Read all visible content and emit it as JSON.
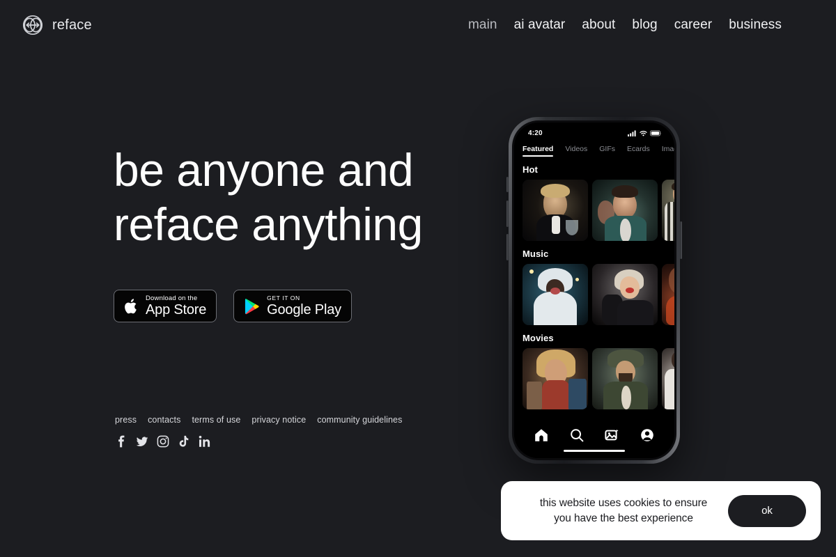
{
  "brand": {
    "name": "reface",
    "icon": "globe-swap-icon"
  },
  "nav": {
    "items": [
      {
        "label": "main",
        "active": false
      },
      {
        "label": "ai avatar"
      },
      {
        "label": "about"
      },
      {
        "label": "blog"
      },
      {
        "label": "career"
      },
      {
        "label": "business"
      }
    ]
  },
  "hero": {
    "headline_line1": "be anyone and",
    "headline_line2": "reface anything",
    "badges": [
      {
        "icon": "apple-icon",
        "small": "Download on the",
        "big": "App Store"
      },
      {
        "icon": "google-play-icon",
        "small": "GET IT ON",
        "big": "Google Play"
      }
    ]
  },
  "footer": {
    "links": [
      "press",
      "contacts",
      "terms of use",
      "privacy notice",
      "community guidelines"
    ],
    "socials": [
      "facebook-icon",
      "twitter-icon",
      "instagram-icon",
      "tiktok-icon",
      "linkedin-icon"
    ]
  },
  "phone": {
    "status": {
      "time": "4:20",
      "icons": [
        "cellular-signal-icon",
        "wifi-icon",
        "battery-icon"
      ]
    },
    "tabs": [
      {
        "label": "Featured",
        "active": true
      },
      {
        "label": "Videos",
        "active": false
      },
      {
        "label": "GIFs",
        "active": false
      },
      {
        "label": "Ecards",
        "active": false
      },
      {
        "label": "Images",
        "active": false
      }
    ],
    "sections": [
      {
        "title": "Hot",
        "items": [
          "leonardo-toast-thumb",
          "party-selfie-thumb",
          "plaid-suit-thumb"
        ]
      },
      {
        "title": "Music",
        "items": [
          "santa-costume-thumb",
          "miley-mic-thumb",
          "warm-stage-thumb"
        ]
      },
      {
        "title": "Movies",
        "items": [
          "iron-man-thumb",
          "jack-sparrow-thumb",
          "white-outfit-thumb"
        ]
      }
    ],
    "bottom_nav": [
      "home-icon",
      "search-icon",
      "photo-magic-icon",
      "profile-icon"
    ]
  },
  "cookie": {
    "text_line1": "this website uses cookies to ensure",
    "text_line2": "you have the best experience",
    "button": "ok"
  },
  "colors": {
    "background": "#1c1d21",
    "text_primary": "#fdfdfd",
    "text_muted": "#b9bbc0",
    "banner_bg": "#ffffff",
    "screen_bg": "#000000"
  }
}
